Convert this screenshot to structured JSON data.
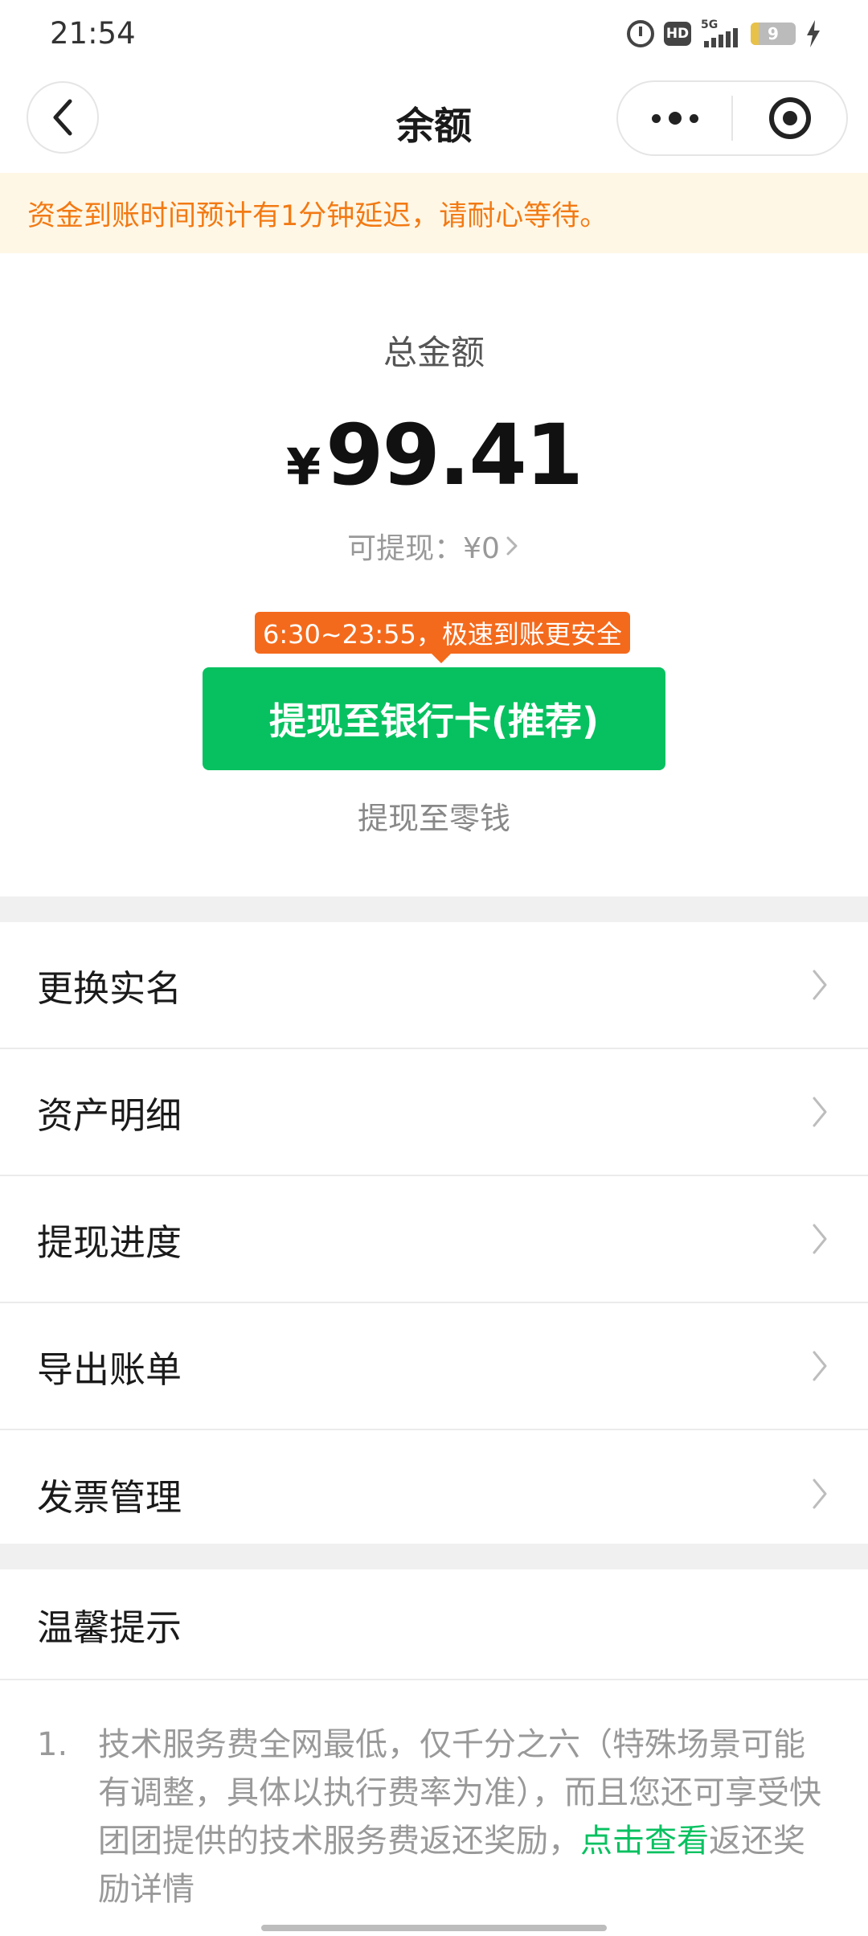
{
  "status_bar": {
    "time": "21:54",
    "hd_label": "HD",
    "network_label": "5G",
    "battery_level": "9",
    "icons": [
      "alarm-icon",
      "hd-icon",
      "signal-icon",
      "battery-icon",
      "charging-icon"
    ]
  },
  "nav": {
    "title": "余额",
    "back_icon": "chevron-left-icon",
    "more_icon": "more-dots-icon",
    "close_icon": "target-icon"
  },
  "notice": {
    "text": "资金到账时间预计有1分钟延迟，请耐心等待。"
  },
  "balance": {
    "total_label": "总金额",
    "currency_symbol": "¥",
    "amount": "99.41",
    "withdrawable_text": "可提现：¥0",
    "promo_tag": "6:30~23:55，极速到账更安全",
    "primary_button": "提现至银行卡(推荐)",
    "secondary_link": "提现至零钱"
  },
  "menu": {
    "items": [
      {
        "label": "更换实名"
      },
      {
        "label": "资产明细"
      },
      {
        "label": "提现进度"
      },
      {
        "label": "导出账单"
      },
      {
        "label": "发票管理"
      }
    ]
  },
  "tips": {
    "title": "温馨提示",
    "items": [
      {
        "index": "1.",
        "text": "技术服务费全网最低，仅千分之六（特殊场景可能有调整，具体以执行费率为准），而且您还可享受快团团提供的技术服务费返还奖励，",
        "link": "点击查看",
        "text_after": "返还奖励详情"
      }
    ]
  },
  "colors": {
    "primary": "#07c160",
    "notice_bg": "#fff7e6",
    "notice_text": "#f27a14",
    "promo_tag": "#f46a1c"
  }
}
